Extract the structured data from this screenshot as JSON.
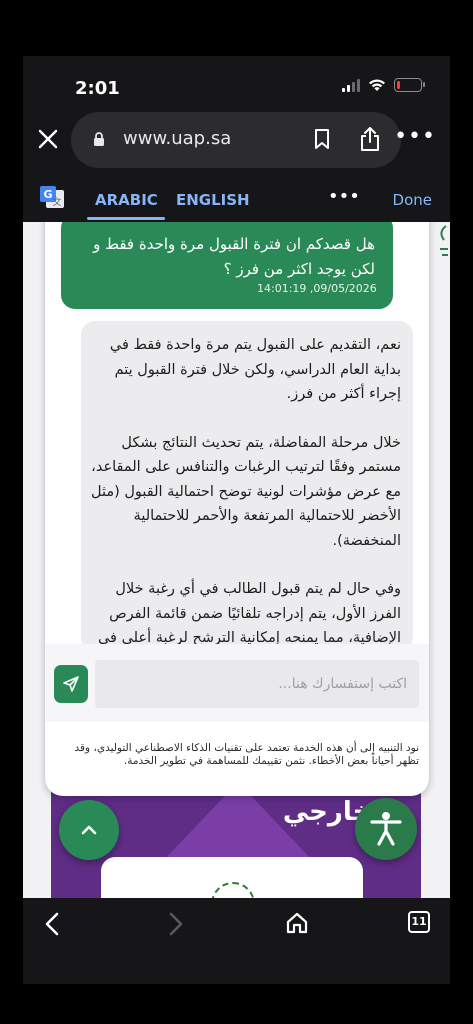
{
  "status_bar": {
    "time": "2:01",
    "battery_level": 0.1
  },
  "browser": {
    "url": "www.uap.sa",
    "close_icon": "close-icon",
    "tab_count": "11"
  },
  "translate": {
    "arabic_label": "ARABIC",
    "english_label": "ENGLISH",
    "more_label": "•••",
    "done_label": "Done"
  },
  "chat": {
    "user_message": {
      "text": "هل قصدكم ان فترة القبول مرة واحدة فقط و لكن يوجد اكثر من فرز ؟",
      "time": "14:01:19 ,09/05/2026"
    },
    "bot_message": {
      "p1": "نعم، التقديم على القبول يتم مرة واحدة فقط في بداية العام الدراسي، ولكن خلال فترة القبول يتم إجراء أكثر من فرز.",
      "p2": "خلال مرحلة المفاضلة، يتم تحديث النتائج بشكل مستمر وفقًا لترتيب الرغبات والتنافس على المقاعد، مع عرض مؤشرات لونية توضح احتمالية القبول (مثل الأخضر للاحتمالية المرتفعة والأحمر للاحتمالية المنخفضة).",
      "p3": "وفي حال لم يتم قبول الطالب في أي رغبة خلال الفرز الأول، يتم إدراجه تلقائيًا ضمن قائمة الفرص الإضافية، مما يمنحه إمكانية الترشح لرغبة أعلى في حال توفر مقاعد لاحقًا."
    },
    "input_placeholder": "اكتب إستفسارك هنا...",
    "disclaimer": "نود التنبيه إلى أن هذه الخدمة تعتمد على تقنيات الذكاء الاصطناعي التوليدي، وقد تظهر أحياناً بعض الأخطاء. نثمن تقييمك للمساهمة في تطوير الخدمة."
  },
  "page": {
    "section_title": "الخارجي"
  },
  "colors": {
    "accent_green": "#2a8a57",
    "translate_blue": "#8ab4f8",
    "purple": "#5f2d86"
  }
}
